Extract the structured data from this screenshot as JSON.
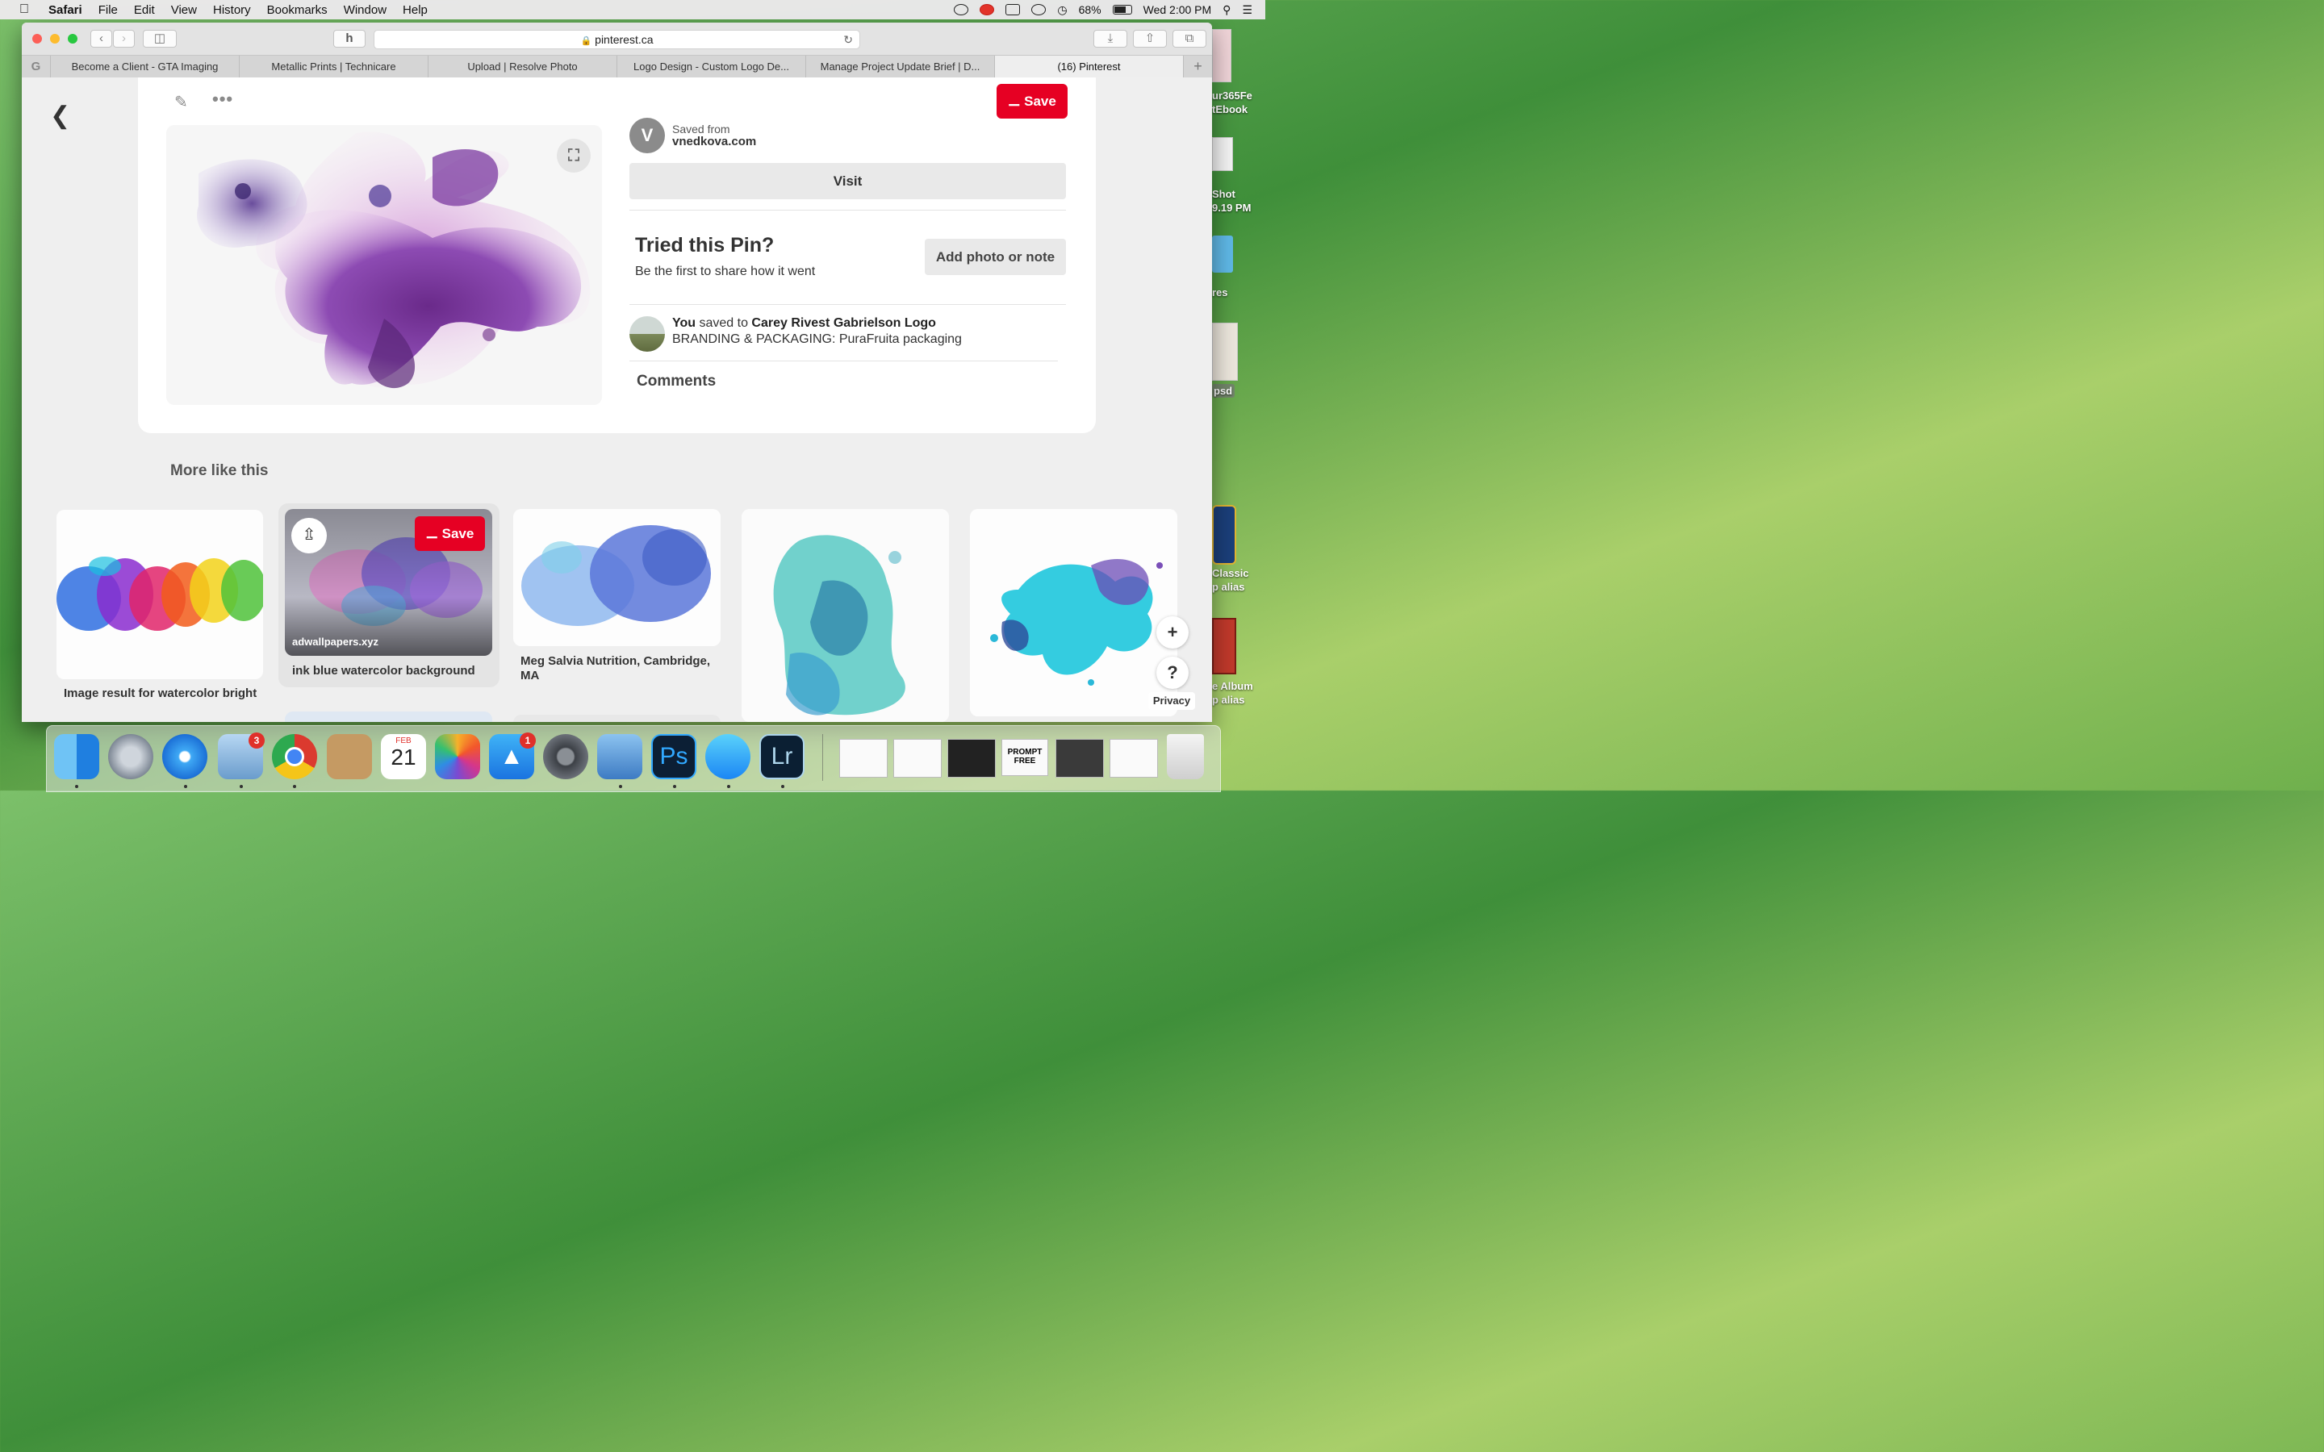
{
  "menubar": {
    "app": "Safari",
    "items": [
      "File",
      "Edit",
      "View",
      "History",
      "Bookmarks",
      "Window",
      "Help"
    ],
    "battery": "68%",
    "clock": "Wed 2:00 PM",
    "battery_level": 0.68
  },
  "desktop": {
    "icons": [
      {
        "label": "ur365Fe\ntEbook"
      },
      {
        "label": "Shot\n9.19 PM"
      },
      {
        "label": "res"
      },
      {
        "label": "psd"
      },
      {
        "label": "Classic\np alias"
      },
      {
        "label": "e Album\np alias"
      }
    ]
  },
  "browser": {
    "address": "pinterest.ca",
    "tabs": [
      "Become a Client - GTA Imaging",
      "Metallic Prints | Technicare",
      "Upload | Resolve Photo",
      "Logo Design - Custom Logo De...",
      "Manage Project Update Brief | D...",
      "(16) Pinterest"
    ],
    "active_tab": 5
  },
  "pin": {
    "save_label": "Save",
    "saved_from_label": "Saved from",
    "saved_from_site": "vnedkova.com",
    "source_initial": "V",
    "visit_label": "Visit",
    "tried_title": "Tried this Pin?",
    "tried_sub": "Be the first to share how it went",
    "add_photo_label": "Add photo or note",
    "you_label": "You",
    "saved_to_label": "saved to",
    "board_owner": "Carey Rivest Gabrielson Logo",
    "board_name": "BRANDING & PACKAGING: PuraFruita packaging",
    "comments_label": "Comments"
  },
  "more_like_this": {
    "heading": "More like this",
    "tiles": [
      {
        "caption": "Image result for watercolor bright"
      },
      {
        "caption": "ink blue watercolor background",
        "domain": "adwallpapers.xyz",
        "save_label": "Save"
      },
      {
        "caption": "Meg Salvia Nutrition, Cambridge, MA"
      },
      {
        "caption": ""
      },
      {
        "caption": ""
      }
    ]
  },
  "floating": {
    "plus": "+",
    "help": "?",
    "privacy": "Privacy"
  },
  "dock": {
    "mail_badge": "3",
    "appstore_badge": "1",
    "calendar_month": "FEB",
    "calendar_day": "21",
    "ps_label": "Ps",
    "lr_label": "Lr",
    "thumb_prompt": "PROMPT FREE"
  }
}
